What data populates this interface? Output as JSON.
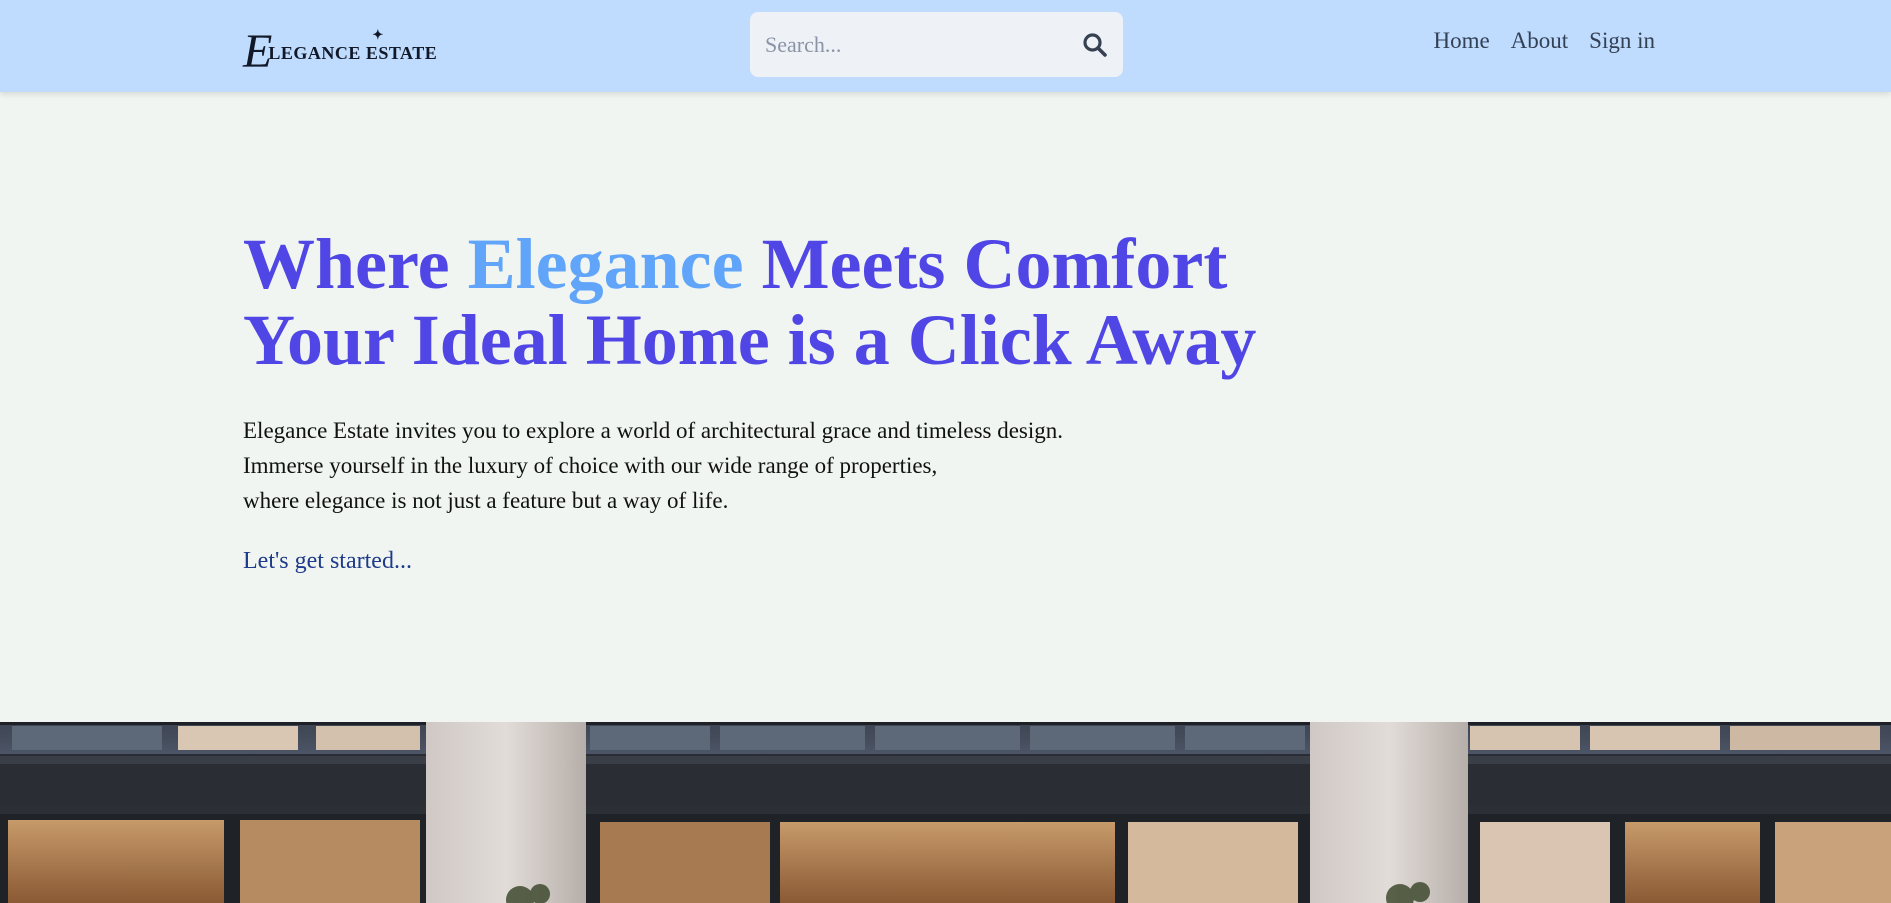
{
  "header": {
    "logo_initial": "E",
    "logo_text": "LEGANCE ESTATE",
    "search": {
      "placeholder": "Search..."
    },
    "nav": [
      "Home",
      "About",
      "Sign in"
    ]
  },
  "hero": {
    "title_line1_pre": "Where ",
    "title_line1_accent": "Elegance",
    "title_line1_post": " Meets Comfort",
    "title_line2": "Your Ideal Home is a Click Away",
    "description": [
      "Elegance Estate invites you to explore a world of architectural grace and timeless design.",
      "Immerse yourself in the luxury of choice with our wide range of properties,",
      "where elegance is not just a feature but a way of life."
    ],
    "cta": "Let's get started..."
  },
  "colors": {
    "header_bg": "#bfdbfe",
    "page_bg": "#f0f5f1",
    "title": "#4f46e5",
    "title_accent": "#60a5fa",
    "cta": "#1e3a8a"
  },
  "icons": {
    "search": "search-icon",
    "logo_sparkle": "sparkle-icon"
  }
}
